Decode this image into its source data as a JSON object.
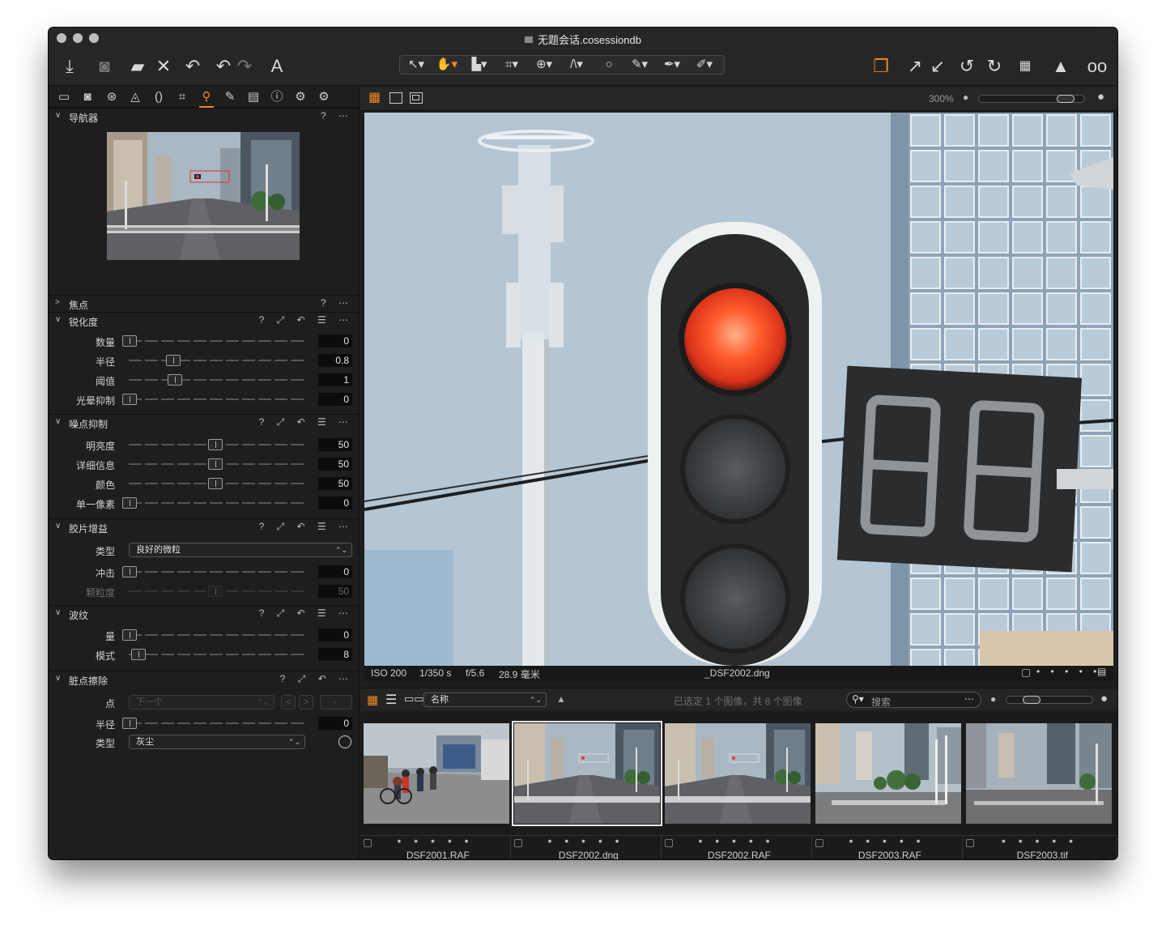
{
  "window": {
    "title": "无题会话.cosessiondb"
  },
  "icons": {
    "toolbar_left": [
      "import-icon",
      "camera-icon",
      "folder-move-icon",
      "delete-icon",
      "undo-icon",
      "undo-alt-icon",
      "redo-icon",
      "text-icon"
    ],
    "toolbar_center": [
      "select-cursor-icon",
      "pan-hand-icon",
      "loupe-icon",
      "crop-icon",
      "rotate-icon",
      "keystone-icon",
      "spot-removal-icon",
      "brush-icon",
      "picker-icon",
      "eraser-icon"
    ],
    "toolbar_right": [
      "copy-adjustments-icon",
      "apply-adjustments-icon",
      "paste-adjustments-icon",
      "rotate-left-icon",
      "rotate-right-icon",
      "grid-icon",
      "warning-icon",
      "proof-glasses-icon"
    ],
    "tool_tabs": [
      "library-tab-icon",
      "capture-tab-icon",
      "color-tab-icon",
      "exposure-tab-icon",
      "lens-tab-icon",
      "crop-tab-icon",
      "details-tab-icon",
      "local-adjust-tab-icon",
      "output-tab-icon",
      "metadata-tab-icon",
      "adjustments-tab-icon",
      "batch-tab-icon"
    ]
  },
  "accent": "#f08a1e",
  "sections": {
    "navigator": {
      "title": "导航器"
    },
    "focus": {
      "title": "焦点"
    },
    "sharpening": {
      "title": "锐化度",
      "rows": [
        {
          "label": "数量",
          "value": "0"
        },
        {
          "label": "半径",
          "value": "0.8"
        },
        {
          "label": "阈值",
          "value": "1"
        },
        {
          "label": "光晕抑制",
          "value": "0"
        }
      ]
    },
    "noise": {
      "title": "噪点抑制",
      "rows": [
        {
          "label": "明亮度",
          "value": "50"
        },
        {
          "label": "详细信息",
          "value": "50"
        },
        {
          "label": "颜色",
          "value": "50"
        },
        {
          "label": "单一像素",
          "value": "0"
        }
      ]
    },
    "grain": {
      "title": "胶片增益",
      "type_label": "类型",
      "type_value": "良好的微粒",
      "rows": [
        {
          "label": "冲击",
          "value": "0"
        },
        {
          "label": "颗粒度",
          "value": "50"
        }
      ]
    },
    "moire": {
      "title": "波纹",
      "rows": [
        {
          "label": "量",
          "value": "0"
        },
        {
          "label": "模式",
          "value": "8"
        }
      ]
    },
    "dust": {
      "title": "脏点擦除",
      "point_label": "点",
      "point_value": "下一个",
      "radius_label": "半径",
      "radius_value": "0",
      "type_label": "类型",
      "type_value": "灰尘",
      "nav_prev": "<",
      "nav_next": ">",
      "nav_dash": "-"
    }
  },
  "viewer": {
    "zoom": "300%",
    "info": {
      "iso": "ISO 200",
      "shutter": "1/350 s",
      "aperture": "f/5.6",
      "focal": "28.9 毫米",
      "filename": "_DSF2002.dng"
    }
  },
  "browser": {
    "sort_value": "名称",
    "status": "已选定 1 个图像，共 8 个图像",
    "search_placeholder": "搜索",
    "thumbnails": [
      {
        "name": "_DSF2001.RAF",
        "stars": "• • • • •"
      },
      {
        "name": "_DSF2002.dng",
        "stars": "• • • • •"
      },
      {
        "name": "_DSF2002.RAF",
        "stars": "• • • • •"
      },
      {
        "name": "_DSF2003.RAF",
        "stars": "• • • • •"
      },
      {
        "name": "_DSF2003.tif",
        "stars": "• • • • •"
      }
    ]
  }
}
